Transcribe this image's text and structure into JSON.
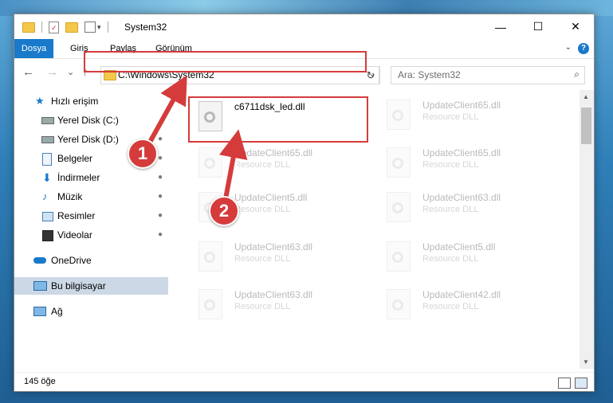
{
  "window": {
    "title": "System32",
    "minimize_glyph": "—",
    "maximize_glyph": "☐",
    "close_glyph": "✕"
  },
  "ribbon": {
    "tabs": [
      {
        "label": "Dosya",
        "active": true
      },
      {
        "label": "Giriş"
      },
      {
        "label": "Paylaş"
      },
      {
        "label": "Görünüm"
      }
    ],
    "help_glyph": "?",
    "expand_glyph": "⌄"
  },
  "nav": {
    "back_glyph": "←",
    "forward_glyph": "→",
    "recent_glyph": "⌄",
    "up_glyph": "↑",
    "address": "C:\\Windows\\System32",
    "address_dropdown_glyph": "⌄",
    "refresh_glyph": "↻",
    "search_placeholder": "Ara: System32",
    "search_glyph": "⌕"
  },
  "sidebar": {
    "items": [
      {
        "label": "Hızlı erişim",
        "icon": "star-icon"
      },
      {
        "label": "Yerel Disk (C:)",
        "icon": "drive-icon",
        "pinned": true
      },
      {
        "label": "Yerel Disk (D:)",
        "icon": "drive-icon",
        "pinned": true
      },
      {
        "label": "Belgeler",
        "icon": "documents-icon",
        "pinned": true
      },
      {
        "label": "İndirmeler",
        "icon": "downloads-icon",
        "pinned": true
      },
      {
        "label": "Müzik",
        "icon": "music-icon",
        "pinned": true
      },
      {
        "label": "Resimler",
        "icon": "pictures-icon",
        "pinned": true
      },
      {
        "label": "Videolar",
        "icon": "videos-icon",
        "pinned": true
      },
      {
        "label": "OneDrive",
        "icon": "cloud-icon"
      },
      {
        "label": "Bu bilgisayar",
        "icon": "computer-icon",
        "selected": true
      },
      {
        "label": "Ağ",
        "icon": "network-icon"
      }
    ],
    "pin_glyph": "📌"
  },
  "files": [
    {
      "name": "c6711dsk_led.dll",
      "type": ""
    },
    {
      "name": "UpdateClient65.dll",
      "type": "Resource DLL"
    },
    {
      "name": "UpdateClient65.dll",
      "type": "Resource DLL"
    },
    {
      "name": "UpdateClient65.dll",
      "type": "Resource DLL"
    },
    {
      "name": "UpdateClient5.dll",
      "type": "Resource DLL"
    },
    {
      "name": "UpdateClient63.dll",
      "type": "Resource DLL"
    },
    {
      "name": "UpdateClient63.dll",
      "type": "Resource DLL"
    },
    {
      "name": "UpdateClient5.dll",
      "type": "Resource DLL"
    },
    {
      "name": "UpdateClient63.dll",
      "type": "Resource DLL"
    },
    {
      "name": "UpdateClient42.dll",
      "type": "Resource DLL"
    }
  ],
  "status": {
    "item_count": "145 öğe"
  },
  "annotations": {
    "step1": "1",
    "step2": "2",
    "color": "#d63b3b"
  }
}
